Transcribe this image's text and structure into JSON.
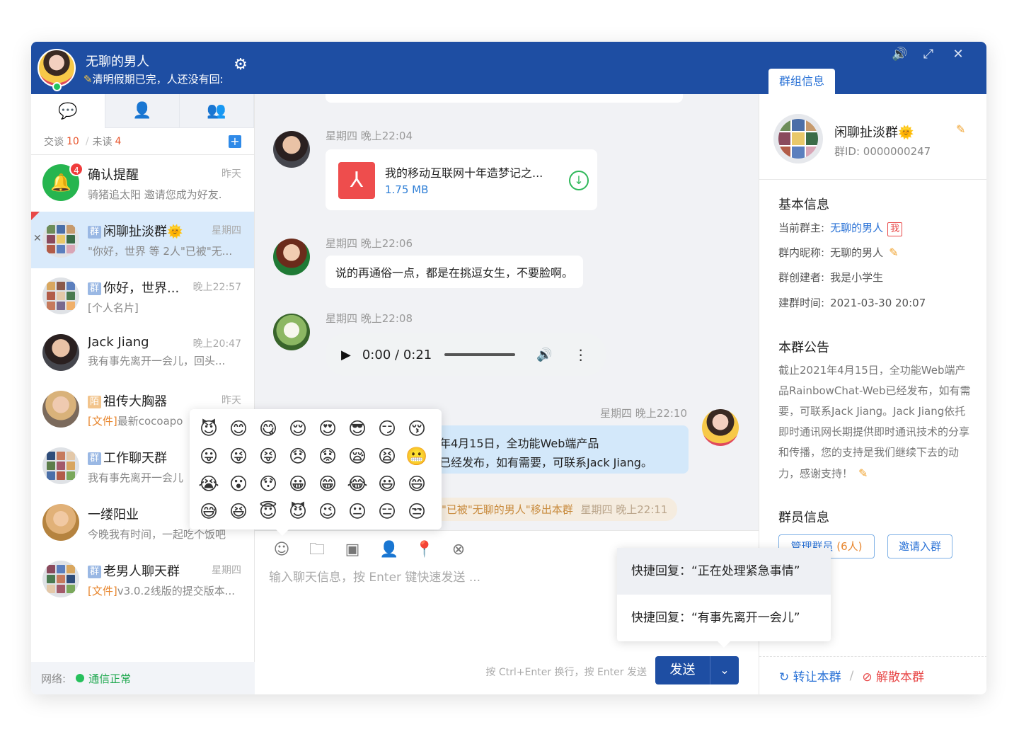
{
  "me": {
    "name": "无聊的男人",
    "signature": "清明假期已完，人还没有回:"
  },
  "top_controls": {
    "sound_icon": "speaker-icon",
    "expand_icon": "expand-icon",
    "close_icon": "close-icon"
  },
  "group_tab": "群组信息",
  "left_tabs": [
    {
      "name": "chat-bubble-icon"
    },
    {
      "name": "contact-list-icon"
    },
    {
      "name": "group-users-icon"
    }
  ],
  "stats": {
    "talk_label": "交谈",
    "talk_count": "10",
    "sep": "/",
    "unread_label": "未读",
    "unread_count": "4"
  },
  "conversations": [
    {
      "title": "确认提醒",
      "time": "昨天",
      "sub": "骑猪追太阳 邀请您成为好友.",
      "badge": "4"
    },
    {
      "tag": "群",
      "title": "闲聊扯淡群🌞",
      "time": "星期四",
      "sub": "\"你好，世界 等 2人\"已被\"无..."
    },
    {
      "tag": "群",
      "title": "你好，世界...",
      "time": "晚上22:57",
      "sub": "[个人名片]"
    },
    {
      "title": "Jack Jiang",
      "time": "晚上20:47",
      "sub": "我有事先离开一会儿，回头..."
    },
    {
      "tag": "陌",
      "title": "祖传大胸器",
      "time": "昨天",
      "sub_tag": "[文件]",
      "sub": "最新cocoapo"
    },
    {
      "tag": "群",
      "title": "工作聊天群",
      "time": "",
      "sub": "我有事先离开一会儿"
    },
    {
      "title": "一缕阳业",
      "time": "",
      "sub": "今晚我有时间，一起吃个饭吧"
    },
    {
      "tag": "群",
      "title": "老男人聊天群",
      "time": "星期四",
      "sub_tag": "[文件]",
      "sub": "v3.0.2线版的提交版本..."
    }
  ],
  "network": {
    "label": "网络:",
    "status": "通信正常"
  },
  "messages": {
    "m1_time": "星期四 晚上22:04",
    "file_name": "我的移动互联网十年造梦记之...",
    "file_size": "1.75 MB",
    "m2_time": "星期四 晚上22:06",
    "m2_text": "说的再通俗一点，都是在挑逗女生，不要脸啊。",
    "m3_time": "星期四 晚上22:08",
    "audio_time": "0:00",
    "audio_sep": "/",
    "audio_total": "0:21",
    "m4_time": "星期四 晚上22:10",
    "m4_line1": "年4月15日，全功能Web端产品",
    "m4_line2": "已经发布，如有需要，可联系Jack Jiang。",
    "sys_note": "\"已被\"无聊的男人\"移出本群",
    "sys_time": "星期四 晚上22:11"
  },
  "emojis": [
    "😈",
    "😊",
    "😋",
    "😌",
    "😍",
    "😎",
    "😏",
    "😚",
    "😛",
    "😜",
    "😝",
    "😞",
    "😟",
    "😪",
    "😫",
    "😬",
    "😭",
    "😮",
    "😯",
    "😀",
    "😁",
    "😂",
    "😃",
    "😄",
    "😅",
    "😆",
    "😇",
    "😈",
    "😉",
    "😐",
    "😑",
    "😒"
  ],
  "toolbar": [
    "smile-icon",
    "folder-icon",
    "image-icon",
    "user-card-icon",
    "location-pin-icon",
    "close-circle-icon"
  ],
  "input": {
    "placeholder": "输入聊天信息，按 Enter 键快速发送 ..."
  },
  "quick_replies": [
    "快捷回复：“正在处理紧急事情”",
    "快捷回复：“有事先离开一会儿”"
  ],
  "send": {
    "hint": "按 Ctrl+Enter 换行，按 Enter 发送",
    "label": "发送"
  },
  "group": {
    "name": "闲聊扯淡群🌞",
    "id": "群ID: 0000000247",
    "basic_title": "基本信息",
    "owner_label": "当前群主:",
    "owner": "无聊的男人",
    "me_tag": "我",
    "nick_label": "群内昵称:",
    "nick": "无聊的男人",
    "creator_label": "群创建者:",
    "creator": "我是小学生",
    "created_label": "建群时间:",
    "created": "2021-03-30 20:07",
    "notice_title": "本群公告",
    "notice": "截止2021年4月15日，全功能Web端产品RainbowChat-Web已经发布，如有需要，可联系Jack Jiang。Jack Jiang依托即时通讯网长期提供即时通讯技术的分享和传播，您的支持是我们继续下去的动力，感谢支持！",
    "members_title": "群员信息",
    "manage_label": "管理群员",
    "manage_count": "(6人)",
    "invite_label": "邀请入群",
    "transfer": "转让本群",
    "sep": "/",
    "dissolve": "解散本群"
  },
  "colors": {
    "brand": "#1e4ea3",
    "accent": "#2a72d6",
    "online": "#26c05c",
    "danger": "#e84848",
    "selected": "#d9eafb"
  }
}
